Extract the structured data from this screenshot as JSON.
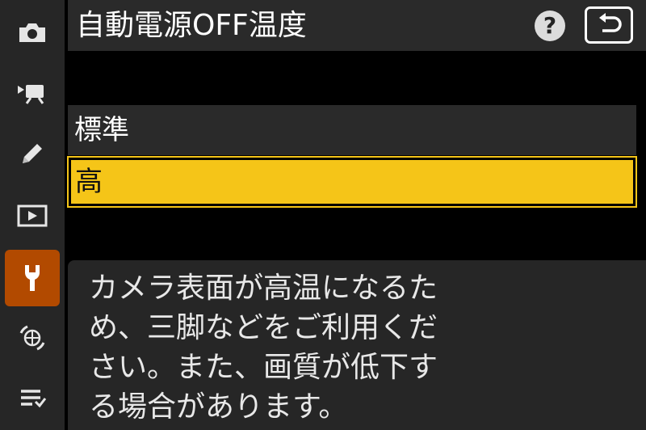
{
  "header": {
    "title": "自動電源OFF温度",
    "help_label": "?",
    "back_icon": "back-arrow-icon"
  },
  "sidebar": {
    "items": [
      {
        "icon": "camera-icon"
      },
      {
        "icon": "movie-icon"
      },
      {
        "icon": "pencil-icon"
      },
      {
        "icon": "playback-icon"
      },
      {
        "icon": "wrench-icon",
        "active": true
      },
      {
        "icon": "network-icon"
      },
      {
        "icon": "my-menu-icon"
      }
    ]
  },
  "options": [
    {
      "label": "標準",
      "selected": false
    },
    {
      "label": "高",
      "selected": true
    }
  ],
  "description": {
    "lines": [
      "カメラ表面が高温になるた",
      "め、三脚などをご利用くだ",
      "さい。また、画質が低下す",
      "る場合があります。"
    ]
  },
  "colors": {
    "accent_active": "#b24a00",
    "selection": "#f5c518",
    "panel": "#2a2a2a"
  }
}
